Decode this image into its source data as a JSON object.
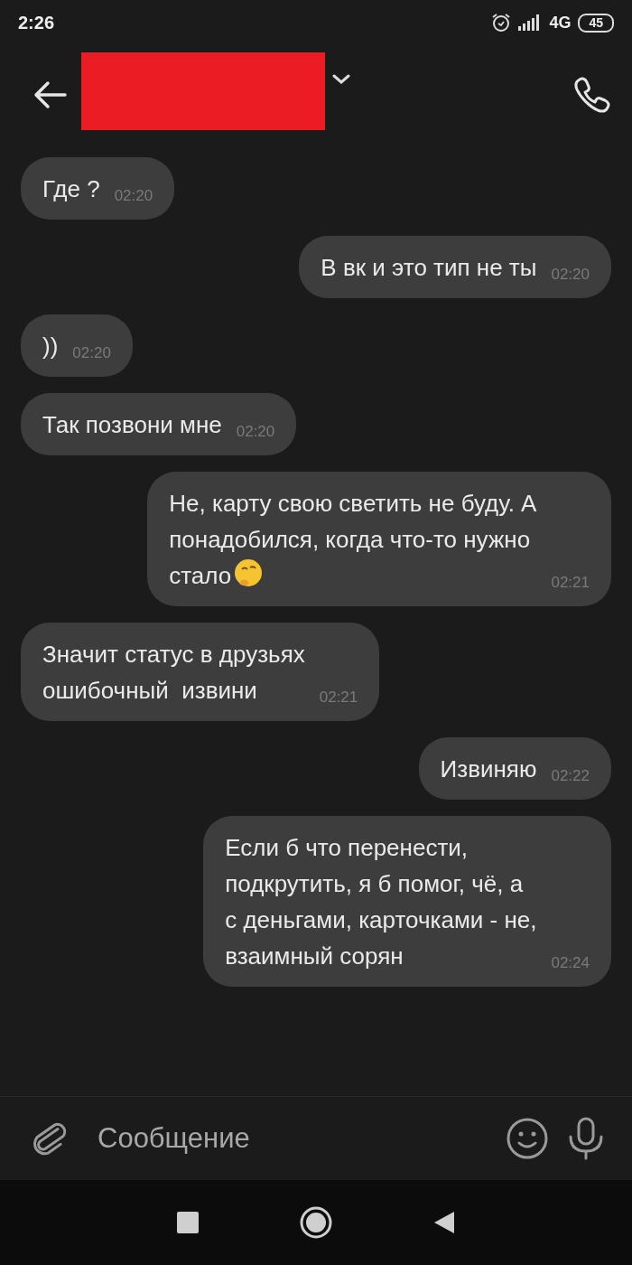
{
  "status_bar": {
    "time": "2:26",
    "network": "4G",
    "battery": "45"
  },
  "header": {
    "redacted": true
  },
  "messages": [
    {
      "kind": "incoming",
      "text": "Где ?",
      "time": "02:20"
    },
    {
      "kind": "outgoing",
      "text": "В вк и это тип не ты",
      "time": "02:20"
    },
    {
      "kind": "incoming",
      "text": "))",
      "time": "02:20"
    },
    {
      "kind": "incoming",
      "text": "Так позвони мне",
      "time": "02:20"
    },
    {
      "kind": "outgoing",
      "text": "Не, карту свою светить не буду. А\nпонадобился, когда что-то нужно\nстало",
      "emoji": true,
      "time": "02:21"
    },
    {
      "kind": "incoming",
      "text": "Значит статус в друзьях\nошибочный  извини",
      "time": "02:21"
    },
    {
      "kind": "outgoing",
      "text": "Извиняю",
      "time": "02:22"
    },
    {
      "kind": "outgoing",
      "text": "Если б что перенести,\nподкрутить, я б помог, чё, а\nс деньгами, карточками - не,\nвзаимный сорян",
      "time": "02:24"
    }
  ],
  "composer": {
    "placeholder": "Сообщение"
  }
}
